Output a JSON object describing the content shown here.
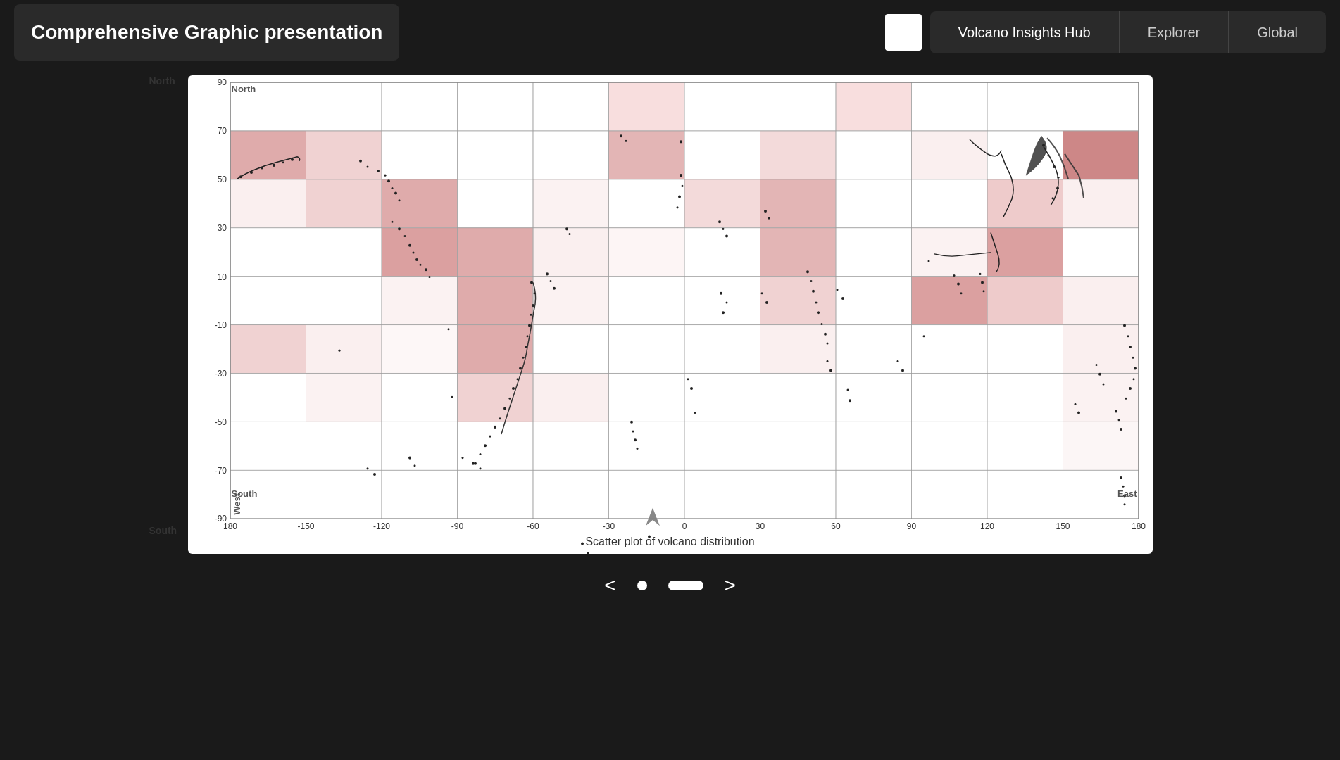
{
  "header": {
    "title": "Comprehensive Graphic presentation",
    "nav_tabs": [
      {
        "label": "Volcano Insights Hub",
        "active": true
      },
      {
        "label": "Explorer",
        "active": false
      },
      {
        "label": "Global",
        "active": false
      }
    ]
  },
  "chart": {
    "title": "Scatter plot of volcano distribution",
    "y_axis": {
      "north_label": "North",
      "south_label": "South",
      "west_label": "West",
      "ticks": [
        90,
        70,
        50,
        30,
        10,
        -10,
        -30,
        -50,
        -70,
        -90
      ]
    },
    "x_axis": {
      "east_label": "East",
      "ticks": [
        -180,
        -150,
        -120,
        -90,
        -60,
        -30,
        0,
        30,
        60,
        90,
        120,
        150,
        180
      ]
    }
  },
  "footer": {
    "prev_label": "<",
    "next_label": ">"
  }
}
